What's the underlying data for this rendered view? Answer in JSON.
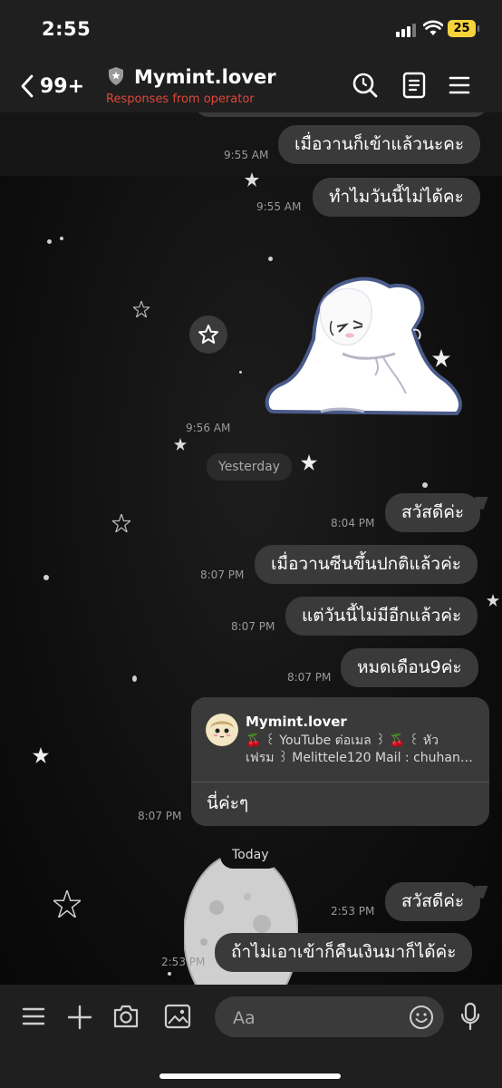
{
  "status_bar": {
    "time": "2:55",
    "battery": "25"
  },
  "header": {
    "back_count": "99+",
    "chat_name": "Mymint.lover",
    "subtitle": "Responses from operator"
  },
  "messages": [
    {
      "text": "เมื่อวานก็เข้าแล้วนะคะ",
      "time": "9:55 AM"
    },
    {
      "text": "ทำไมวันนี้ไม่ได้คะ",
      "time": "9:55 AM"
    },
    {
      "time": "9:56 AM"
    },
    {
      "text": "สวัสดีค่ะ",
      "time": "8:04 PM"
    },
    {
      "text": "เมื่อวานซีนขึ้นปกติแล้วค่ะ",
      "time": "8:07 PM"
    },
    {
      "text": "แต่วันนี้ไม่มีอีกแล้วค่ะ",
      "time": "8:07 PM"
    },
    {
      "text": "หมดเดือน9ค่ะ",
      "time": "8:07 PM"
    },
    {
      "text": "นี่ค่ะๆ",
      "time": "8:07 PM"
    },
    {
      "text": "สวัสดีค่ะ",
      "time": "2:53 PM"
    },
    {
      "text": "ถ้าไม่เอาเข้าก็คืนเงินมาก็ได้ค่ะ",
      "time": "2:53 PM"
    }
  ],
  "date_separators": {
    "yesterday": "Yesterday",
    "today": "Today"
  },
  "quote": {
    "name": "Mymint.lover",
    "line1": "🍒 ꒰ YouTube ต่อเมล ꒱ 🍒 ꒰ หัว",
    "line2": "เฟรม ꒱ Melittele120 Mail : chuhanngocmai..."
  },
  "input": {
    "placeholder": "Aa"
  },
  "colors": {
    "bubble": "#3a3a3a",
    "bar": "#1f1f1f",
    "operator_red": "#e0463a",
    "battery": "#f4d43a"
  },
  "icons": [
    "back-chevron-icon",
    "verified-shield-icon",
    "search-icon",
    "notes-icon",
    "menu-icon",
    "star-icon",
    "list-icon",
    "plus-icon",
    "camera-icon",
    "image-icon",
    "emoji-icon",
    "microphone-icon"
  ]
}
